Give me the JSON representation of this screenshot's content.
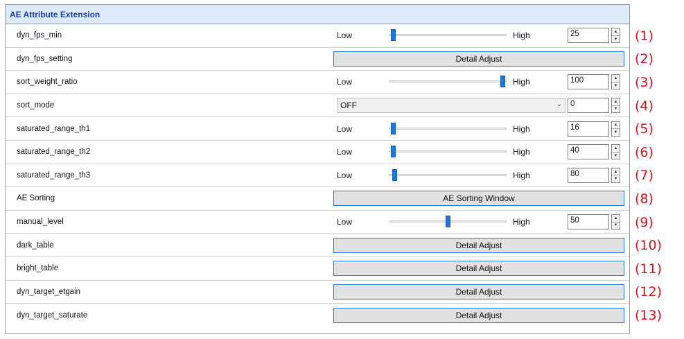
{
  "header": {
    "title": "AE Attribute Extension"
  },
  "rows": [
    {
      "label": "dyn_fps_min",
      "kind": "slider",
      "low": "Low",
      "high": "High",
      "value": "25",
      "level": 0.03,
      "annotation": "(1)"
    },
    {
      "label": "dyn_fps_setting",
      "kind": "button",
      "button_label": "Detail Adjust",
      "annotation": "(2)"
    },
    {
      "label": "sort_weight_ratio",
      "kind": "slider",
      "low": "Low",
      "high": "High",
      "value": "100",
      "level": 0.97,
      "annotation": "(3)"
    },
    {
      "label": "sort_mode",
      "kind": "select",
      "selected": "OFF",
      "value": "0",
      "annotation": "(4)"
    },
    {
      "label": "saturated_range_th1",
      "kind": "slider",
      "low": "Low",
      "high": "High",
      "value": "16",
      "level": 0.03,
      "annotation": "(5)"
    },
    {
      "label": "saturated_range_th2",
      "kind": "slider",
      "low": "Low",
      "high": "High",
      "value": "40",
      "level": 0.03,
      "annotation": "(6)"
    },
    {
      "label": "saturated_range_th3",
      "kind": "slider",
      "low": "Low",
      "high": "High",
      "value": "80",
      "level": 0.04,
      "annotation": "(7)"
    },
    {
      "label": "AE Sorting",
      "kind": "button",
      "button_label": "AE Sorting Window",
      "annotation": "(8)"
    },
    {
      "label": "manual_level",
      "kind": "slider",
      "low": "Low",
      "high": "High",
      "value": "50",
      "level": 0.5,
      "annotation": "(9)"
    },
    {
      "label": "dark_table",
      "kind": "button",
      "button_label": "Detail Adjust",
      "annotation": "(10)"
    },
    {
      "label": "bright_table",
      "kind": "button",
      "button_label": "Detail Adjust",
      "annotation": "(11)"
    },
    {
      "label": "dyn_target_etgain",
      "kind": "button",
      "button_label": "Detail Adjust",
      "annotation": "(12)"
    },
    {
      "label": "dyn_target_saturate",
      "kind": "button",
      "button_label": "Detail Adjust",
      "annotation": "(13)"
    }
  ],
  "colors": {
    "header_bg": "#dce9f8",
    "header_text": "#1a3fa8",
    "accent": "#1e78d6",
    "annotation": "#d0101a"
  },
  "icons": {
    "spin_up": "spin-up-icon",
    "spin_down": "spin-down-icon",
    "dropdown": "chevron-down-icon"
  }
}
